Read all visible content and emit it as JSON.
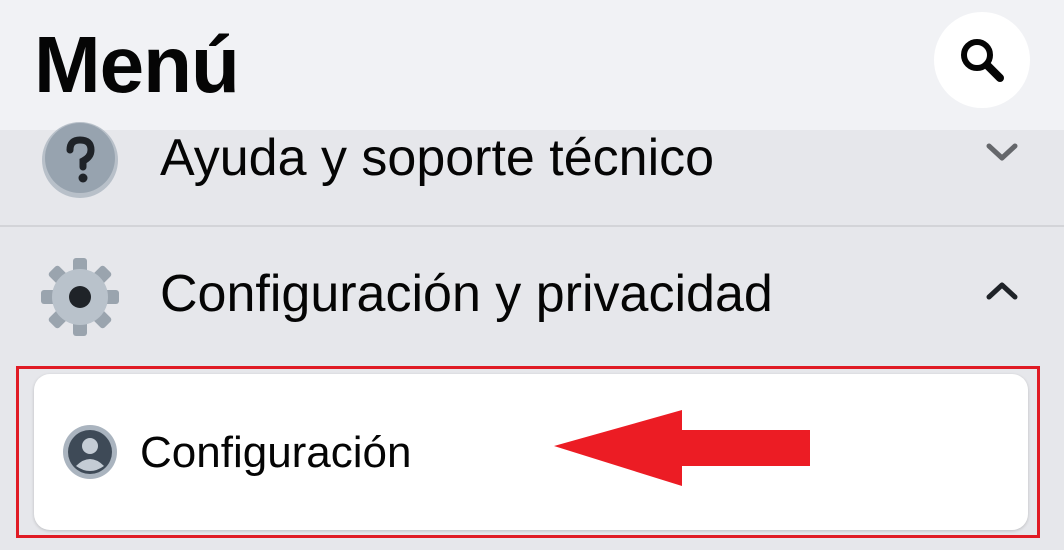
{
  "header": {
    "title": "Menú",
    "search_icon": "search-icon"
  },
  "menu": {
    "help": {
      "label": "Ayuda y soporte técnico",
      "icon": "question-icon",
      "chevron": "chevron-down-icon"
    },
    "settings": {
      "label": "Configuración y privacidad",
      "icon": "gear-icon",
      "chevron": "chevron-up-icon",
      "expanded": true,
      "items": [
        {
          "label": "Configuración",
          "icon": "user-avatar-icon"
        }
      ]
    }
  },
  "annotation": {
    "frame_color": "#e01b24",
    "arrow_color": "#ec1c24"
  },
  "colors": {
    "header_bg": "#f1f2f5",
    "page_bg": "#e6e7eb",
    "card_bg": "#ffffff",
    "text": "#050505",
    "icon_gray": "#8f99a5"
  }
}
